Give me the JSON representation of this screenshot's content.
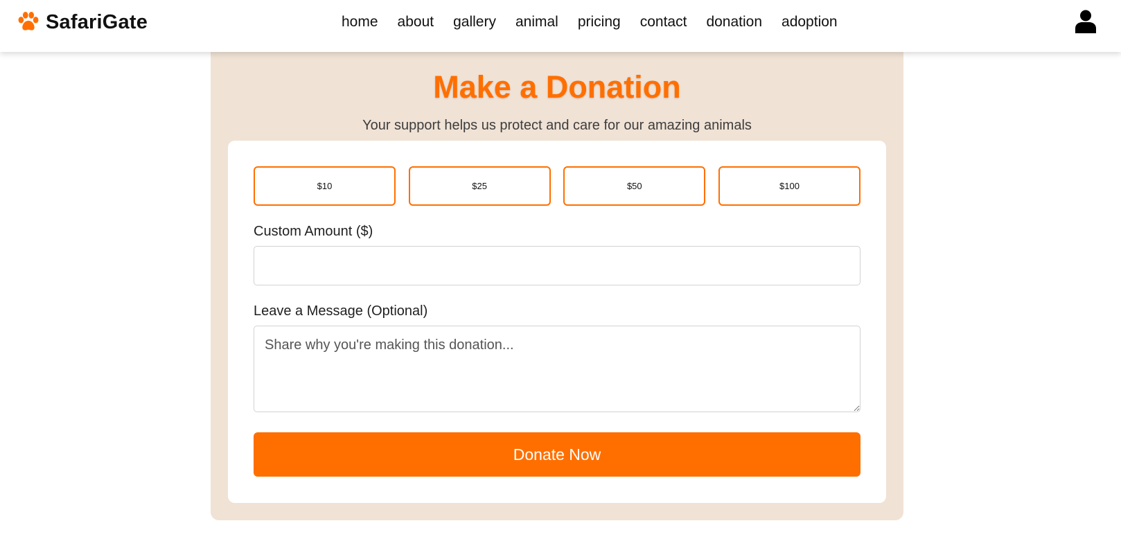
{
  "brand": {
    "name": "SafariGate",
    "icon": "paw-icon",
    "accent_color": "#ff6f00"
  },
  "nav": {
    "links": [
      "home",
      "about",
      "gallery",
      "animal",
      "pricing",
      "contact",
      "donation",
      "adoption"
    ],
    "user_icon": "user-icon"
  },
  "donation": {
    "title": "Make a Donation",
    "subtitle": "Your support helps us protect and care for our amazing animals",
    "preset_amounts": [
      "$10",
      "$25",
      "$50",
      "$100"
    ],
    "custom_amount_label": "Custom Amount ($)",
    "custom_amount_value": "",
    "message_label": "Leave a Message (Optional)",
    "message_placeholder": "Share why you're making this donation...",
    "submit_label": "Donate Now",
    "colors": {
      "primary": "#ff6f00",
      "section_bg": "#f0e2d5",
      "card_bg": "#ffffff"
    }
  }
}
